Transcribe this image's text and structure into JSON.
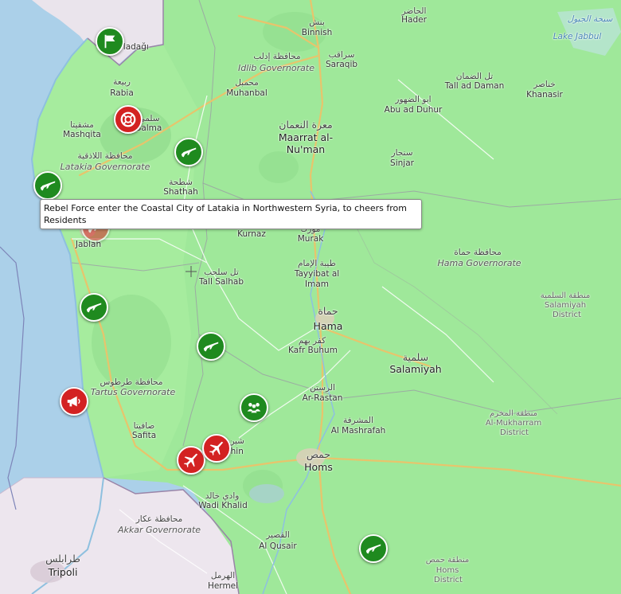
{
  "map": {
    "labels": [
      {
        "id": "hader-ar",
        "text": "الحاضر",
        "cls": "ar"
      },
      {
        "id": "hader",
        "text": "Hader",
        "cls": ""
      },
      {
        "id": "binnish-ar",
        "text": "بنش",
        "cls": "ar"
      },
      {
        "id": "binnish",
        "text": "Binnish",
        "cls": ""
      },
      {
        "id": "idlib-gov-ar",
        "text": "محافظة إدلب",
        "cls": "ar"
      },
      {
        "id": "idlib-gov",
        "text": "Idlib Governorate",
        "cls": "gov"
      },
      {
        "id": "saraqib-ar",
        "text": "سراقب",
        "cls": "ar"
      },
      {
        "id": "saraqib",
        "text": "Saraqib",
        "cls": ""
      },
      {
        "id": "lake-jabbul-ar",
        "text": "سبخة الجبول",
        "cls": "water"
      },
      {
        "id": "lake-jabbul",
        "text": "Lake Jabbul",
        "cls": "water"
      },
      {
        "id": "yayladagi",
        "text": "Yayladağı",
        "cls": ""
      },
      {
        "id": "rabia-ar",
        "text": "ربيعة",
        "cls": "ar"
      },
      {
        "id": "rabia",
        "text": "Rabia",
        "cls": ""
      },
      {
        "id": "muhanbal-ar",
        "text": "محمبل",
        "cls": "ar"
      },
      {
        "id": "muhanbal",
        "text": "Muhanbal",
        "cls": ""
      },
      {
        "id": "tall-ad-daman-ar",
        "text": "تل الضمان",
        "cls": "ar"
      },
      {
        "id": "tall-ad-daman",
        "text": "Tall ad Daman",
        "cls": ""
      },
      {
        "id": "khanasir-ar",
        "text": "خناصر",
        "cls": "ar"
      },
      {
        "id": "khanasir",
        "text": "Khanasir",
        "cls": ""
      },
      {
        "id": "abu-ad-duhur-ar",
        "text": "ابو الضهور",
        "cls": "ar"
      },
      {
        "id": "abu-ad-duhur",
        "text": "Abu ad Duhur",
        "cls": ""
      },
      {
        "id": "salma-ar",
        "text": "سلمى",
        "cls": "ar"
      },
      {
        "id": "salma",
        "text": "Salma",
        "cls": ""
      },
      {
        "id": "mashqita-ar",
        "text": "مشقيتا",
        "cls": "ar"
      },
      {
        "id": "mashqita",
        "text": "Mashqita",
        "cls": ""
      },
      {
        "id": "maarrat-ar",
        "text": "معرة النعمان",
        "cls": "ar big"
      },
      {
        "id": "maarrat-1",
        "text": "Maarrat al-",
        "cls": "big"
      },
      {
        "id": "maarrat-2",
        "text": "Nu'man",
        "cls": "big"
      },
      {
        "id": "sinjar-ar",
        "text": "سنجار",
        "cls": "ar"
      },
      {
        "id": "sinjar",
        "text": "Sinjar",
        "cls": ""
      },
      {
        "id": "latakia-gov-ar",
        "text": "محافظة اللاذقية",
        "cls": "ar"
      },
      {
        "id": "latakia-gov",
        "text": "Latakia Governorate",
        "cls": "gov"
      },
      {
        "id": "shathah-ar",
        "text": "شطحة",
        "cls": "ar"
      },
      {
        "id": "shathah",
        "text": "Shathah",
        "cls": ""
      },
      {
        "id": "kurnaz",
        "text": "Kurnaz",
        "cls": ""
      },
      {
        "id": "murak-ar",
        "text": "مورك",
        "cls": "ar"
      },
      {
        "id": "murak",
        "text": "Murak",
        "cls": ""
      },
      {
        "id": "jablah",
        "text": "Jablah",
        "cls": ""
      },
      {
        "id": "hama-gov-ar",
        "text": "محافظة حماة",
        "cls": "ar"
      },
      {
        "id": "hama-gov",
        "text": "Hama Governorate",
        "cls": "gov"
      },
      {
        "id": "tayyibat-ar",
        "text": "طيبة الإمام",
        "cls": "ar"
      },
      {
        "id": "tayyibat-1",
        "text": "Tayyibat al",
        "cls": ""
      },
      {
        "id": "tayyibat-2",
        "text": "Imam",
        "cls": ""
      },
      {
        "id": "tall-salhab-ar",
        "text": "تل سلحب",
        "cls": "ar"
      },
      {
        "id": "tall-salhab",
        "text": "Tall Salhab",
        "cls": ""
      },
      {
        "id": "salamiyah-dist-ar",
        "text": "منطقة السلمية",
        "cls": "ar dist"
      },
      {
        "id": "salamiyah-dist-1",
        "text": "Salamiyah",
        "cls": "dist"
      },
      {
        "id": "salamiyah-dist-2",
        "text": "District",
        "cls": "dist"
      },
      {
        "id": "hama-ar",
        "text": "حماة",
        "cls": "ar big"
      },
      {
        "id": "hama",
        "text": "Hama",
        "cls": "big"
      },
      {
        "id": "kafr-buhum-ar",
        "text": "كفر بهم",
        "cls": "ar"
      },
      {
        "id": "kafr-buhum",
        "text": "Kafr Buhum",
        "cls": ""
      },
      {
        "id": "salamiyah-ar",
        "text": "سلمية",
        "cls": "ar big"
      },
      {
        "id": "salamiyah",
        "text": "Salamiyah",
        "cls": "big"
      },
      {
        "id": "tartus-gov-ar",
        "text": "محافظة طرطوس",
        "cls": "ar"
      },
      {
        "id": "tartus-gov",
        "text": "Tartus Governorate",
        "cls": "gov"
      },
      {
        "id": "ar-rastan-ar",
        "text": "الرستن",
        "cls": "ar"
      },
      {
        "id": "ar-rastan",
        "text": "Ar-Rastan",
        "cls": ""
      },
      {
        "id": "safita-ar",
        "text": "صافيتا",
        "cls": "ar"
      },
      {
        "id": "safita",
        "text": "Safita",
        "cls": ""
      },
      {
        "id": "al-mashrafah-ar",
        "text": "المشرفة",
        "cls": "ar"
      },
      {
        "id": "al-mashrafah",
        "text": "Al Mashrafah",
        "cls": ""
      },
      {
        "id": "mukharram-dist-ar",
        "text": "منطقة المخرم",
        "cls": "ar dist"
      },
      {
        "id": "mukharram-dist-1",
        "text": "Al-Mukharram",
        "cls": "dist"
      },
      {
        "id": "mukharram-dist-2",
        "text": "District",
        "cls": "dist"
      },
      {
        "id": "sasin-ar",
        "text": "شين",
        "cls": "ar"
      },
      {
        "id": "sasin",
        "text": "shin",
        "cls": ""
      },
      {
        "id": "homs-ar",
        "text": "حمص",
        "cls": "ar big"
      },
      {
        "id": "homs",
        "text": "Homs",
        "cls": "big"
      },
      {
        "id": "wadi-khalid-ar",
        "text": "وادي خالد",
        "cls": "ar"
      },
      {
        "id": "wadi-khalid",
        "text": "Wadi Khalid",
        "cls": ""
      },
      {
        "id": "akkar-gov-ar",
        "text": "محافظة عكار",
        "cls": "ar"
      },
      {
        "id": "akkar-gov",
        "text": "Akkar Governorate",
        "cls": "gov"
      },
      {
        "id": "al-qusair-ar",
        "text": "القصير",
        "cls": "ar"
      },
      {
        "id": "al-qusair",
        "text": "Al Qusair",
        "cls": ""
      },
      {
        "id": "tripoli-ar",
        "text": "طرابلس",
        "cls": "ar big"
      },
      {
        "id": "tripoli",
        "text": "Tripoli",
        "cls": "big"
      },
      {
        "id": "hermel-ar",
        "text": "الهرمل",
        "cls": "ar"
      },
      {
        "id": "hermel",
        "text": "Hermel",
        "cls": ""
      },
      {
        "id": "homs-dist-ar",
        "text": "منطقة حمص",
        "cls": "ar dist"
      },
      {
        "id": "homs-dist-1",
        "text": "Homs",
        "cls": "dist"
      },
      {
        "id": "homs-dist-2",
        "text": "District",
        "cls": "dist"
      },
      {
        "id": "residents-prefix",
        "text": "Re",
        "cls": ""
      }
    ],
    "markers": [
      {
        "id": "yayladagi",
        "color": "green",
        "icon": "flag-icon",
        "faded": false
      },
      {
        "id": "salma",
        "color": "red",
        "icon": "lifebuoy-icon",
        "faded": false
      },
      {
        "id": "shathah",
        "color": "green",
        "icon": "rifle-icon",
        "faded": false
      },
      {
        "id": "latakia-coast",
        "color": "green",
        "icon": "rifle-icon",
        "faded": false
      },
      {
        "id": "jablah",
        "color": "red",
        "icon": "rifle-icon",
        "faded": true
      },
      {
        "id": "baniyas",
        "color": "green",
        "icon": "rifle-icon",
        "faded": false
      },
      {
        "id": "masyaf",
        "color": "green",
        "icon": "rifle-icon",
        "faded": false
      },
      {
        "id": "tartus",
        "color": "red",
        "icon": "megaphone-icon",
        "faded": false
      },
      {
        "id": "ar-rastan",
        "color": "green",
        "icon": "people-icon",
        "faded": false
      },
      {
        "id": "airport-west",
        "color": "red",
        "icon": "plane-icon",
        "faded": false
      },
      {
        "id": "airport-east",
        "color": "red",
        "icon": "plane-icon",
        "faded": false
      },
      {
        "id": "homs-east",
        "color": "green",
        "icon": "rifle-icon",
        "faded": false
      }
    ]
  },
  "tooltip": {
    "text": "Rebel Force enter the Coastal City of Latakia in Northwestern Syria, to cheers from Residents"
  }
}
